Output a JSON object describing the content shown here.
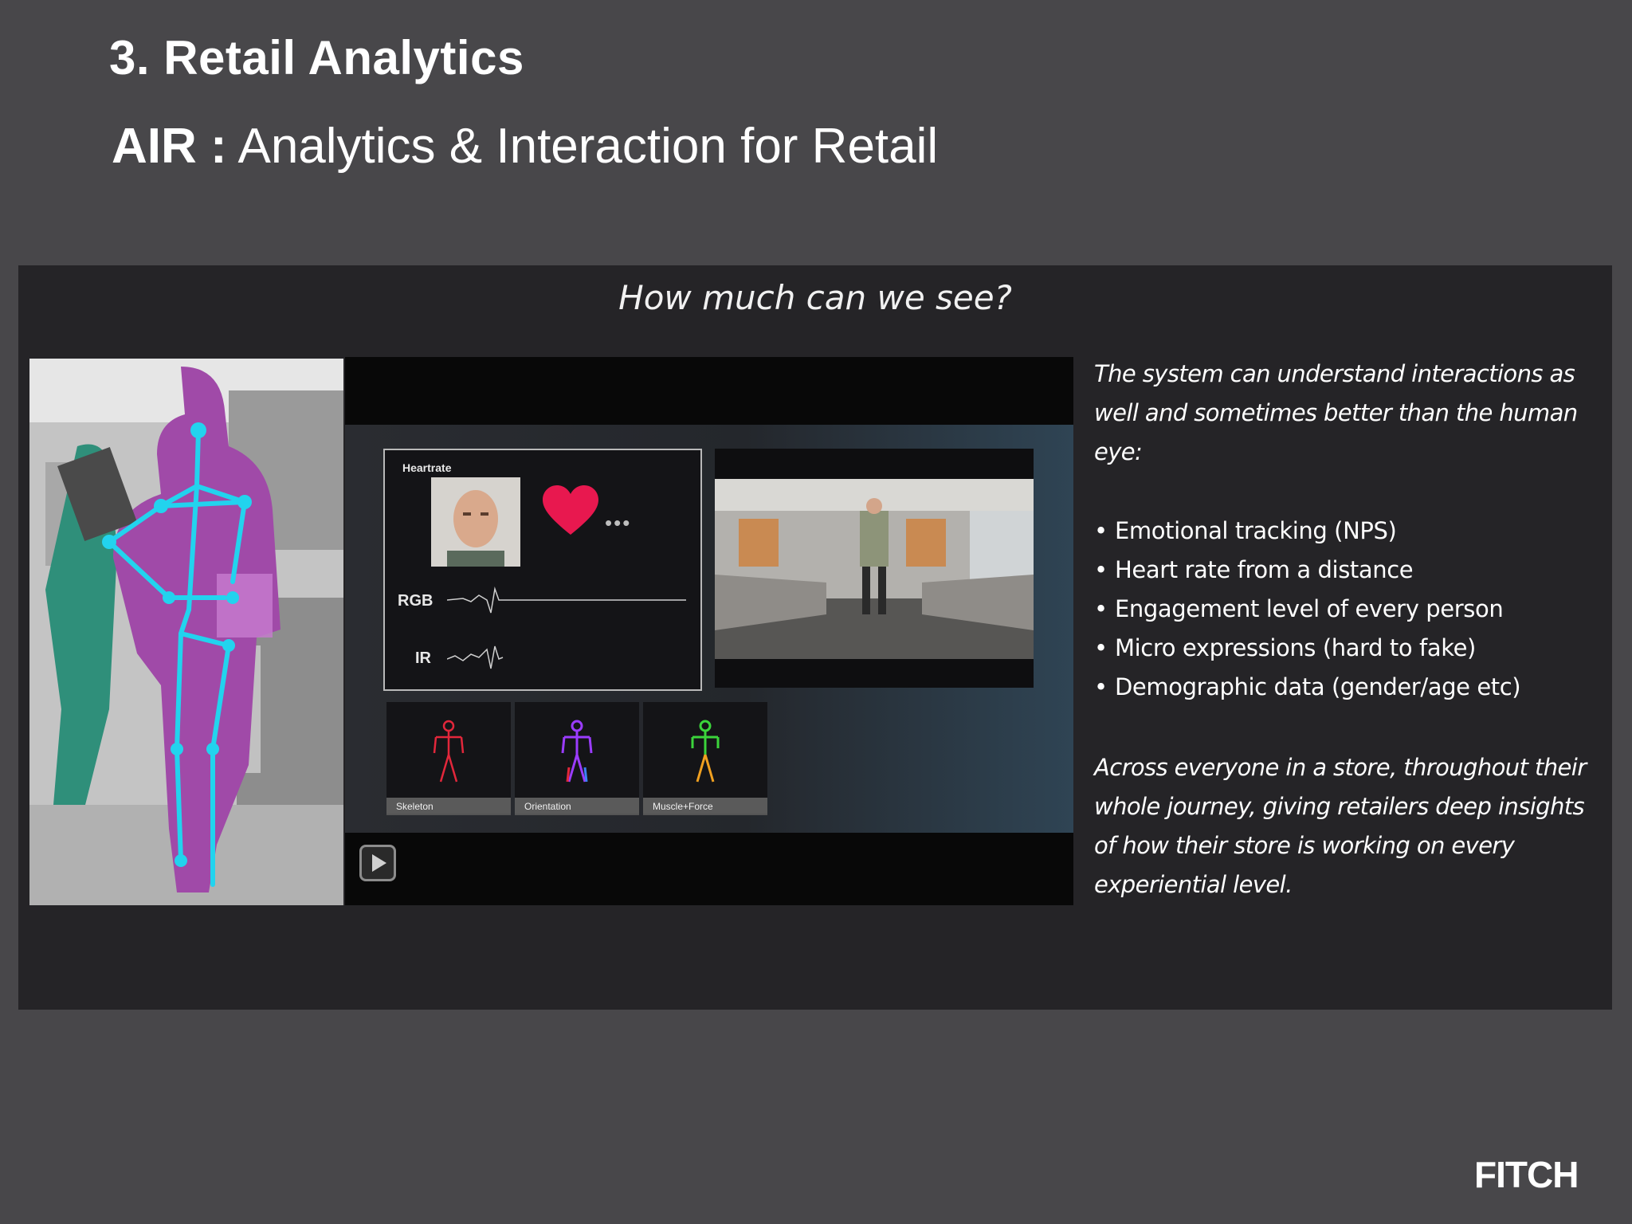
{
  "slide": {
    "title": "3. Retail Analytics",
    "subtitle_bold": "AIR :",
    "subtitle_rest": " Analytics & Interaction for Retail"
  },
  "panel": {
    "heading": "How much can we see?",
    "video": {
      "heartrate_label": "Heartrate",
      "rgb_label": "RGB",
      "ir_label": "IR",
      "thumbnails": [
        {
          "label": "Skeleton",
          "color": "#e2273b"
        },
        {
          "label": "Orientation",
          "color": "#9b3cff"
        },
        {
          "label": "Muscle+Force",
          "color": "#3bd43b"
        }
      ],
      "heart_color": "#e8184f",
      "play_icon": "play-icon"
    },
    "text": {
      "intro": "The system can understand interactions as well and sometimes better than the human eye:",
      "bullets": [
        "Emotional tracking (NPS)",
        "Heart rate from a distance",
        "Engagement level of every person",
        "Micro expressions (hard to fake)",
        "Demographic data (gender/age etc)"
      ],
      "outro": "Across everyone in a store, throughout their whole journey, giving retailers deep insights of how their store is working on every experiential level."
    }
  },
  "brand": {
    "logo_text": "FITCH"
  },
  "colors": {
    "background": "#48474a",
    "panel": "#252427",
    "skeleton_overlay": "#22d3ee",
    "person_overlay": "#a04aa8",
    "person2_overlay": "#2f8f7a"
  }
}
